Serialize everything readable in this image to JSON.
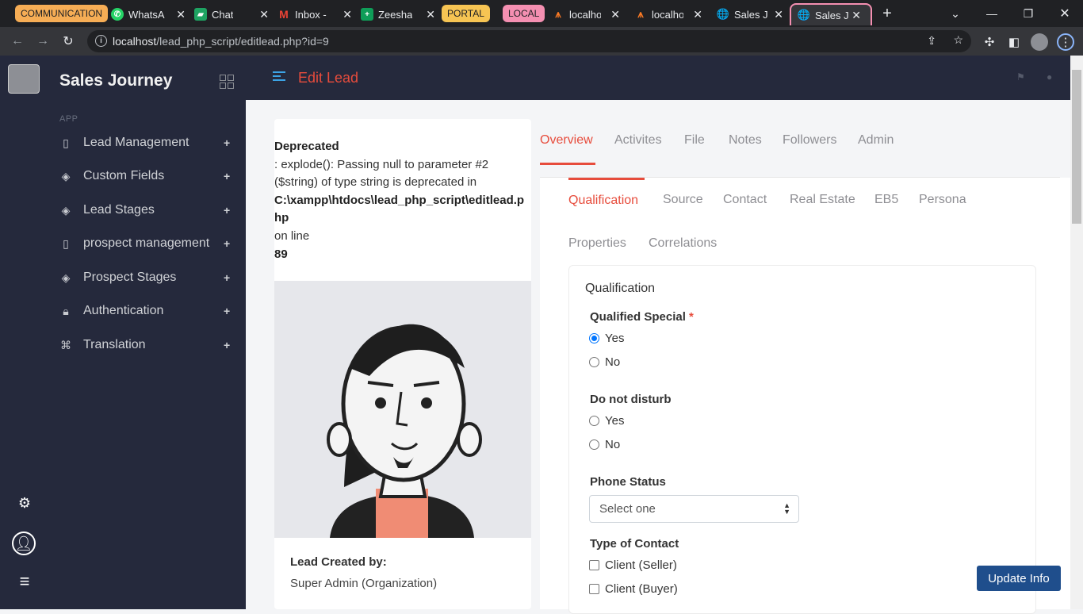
{
  "browser": {
    "groups": [
      {
        "label": "COMMUNICATION",
        "color": "#f6ad55"
      },
      {
        "label": "PORTAL",
        "color": "#f6c453"
      },
      {
        "label": "LOCAL",
        "color": "#f48fb1"
      }
    ],
    "tabs": [
      {
        "label": "WhatsA",
        "icon": "whatsapp-icon"
      },
      {
        "label": "Chat",
        "icon": "chat-icon"
      },
      {
        "label": "Inbox -",
        "icon": "gmail-icon"
      },
      {
        "label": "Zeesha",
        "icon": "sheets-icon"
      },
      {
        "label": "localho",
        "icon": "xampp-icon"
      },
      {
        "label": "localho",
        "icon": "xampp-icon"
      },
      {
        "label": "Sales Jo",
        "icon": "globe-icon"
      },
      {
        "label": "Sales Jo",
        "icon": "globe-icon"
      }
    ],
    "url_host": "localhost",
    "url_path": "/lead_php_script/editlead.php?id=9"
  },
  "sidebar": {
    "brand": "Sales Journey",
    "section": "APP",
    "items": [
      {
        "label": "Lead Management",
        "icon": "book-icon"
      },
      {
        "label": "Custom Fields",
        "icon": "tag-icon"
      },
      {
        "label": "Lead Stages",
        "icon": "tag-icon"
      },
      {
        "label": "prospect management",
        "icon": "book-icon"
      },
      {
        "label": "Prospect Stages",
        "icon": "tag-icon"
      },
      {
        "label": "Authentication",
        "icon": "lock-icon"
      },
      {
        "label": "Translation",
        "icon": "translate-icon"
      }
    ],
    "plus": "+"
  },
  "topbar": {
    "title": "Edit Lead"
  },
  "notice": {
    "heading": "Deprecated",
    "message": ": explode(): Passing null to parameter #2 ($string) of type string is deprecated in",
    "file": "C:\\xampp\\htdocs\\lead_php_script\\editlead.php",
    "on_line": "on line",
    "line": "89"
  },
  "lead": {
    "created_label": "Lead Created by:",
    "created_value": "Super Admin (Organization)"
  },
  "main_tabs": [
    "Overview",
    "Activites",
    "File",
    "Notes",
    "Followers",
    "Admin"
  ],
  "sub_tabs": [
    "Qualification",
    "Source",
    "Contact",
    "Real Estate",
    "EB5",
    "Persona",
    "Properties",
    "Correlations"
  ],
  "form": {
    "section_title": "Qualification",
    "qualified_special": {
      "label": "Qualified Special",
      "required": "*",
      "options": [
        "Yes",
        "No"
      ],
      "selected": "Yes"
    },
    "do_not_disturb": {
      "label": "Do not disturb",
      "options": [
        "Yes",
        "No"
      ]
    },
    "phone_status": {
      "label": "Phone Status",
      "value": "Select one"
    },
    "type_of_contact": {
      "label": "Type of Contact",
      "options": [
        "Client (Seller)",
        "Client (Buyer)"
      ]
    }
  },
  "actions": {
    "update": "Update Info"
  }
}
